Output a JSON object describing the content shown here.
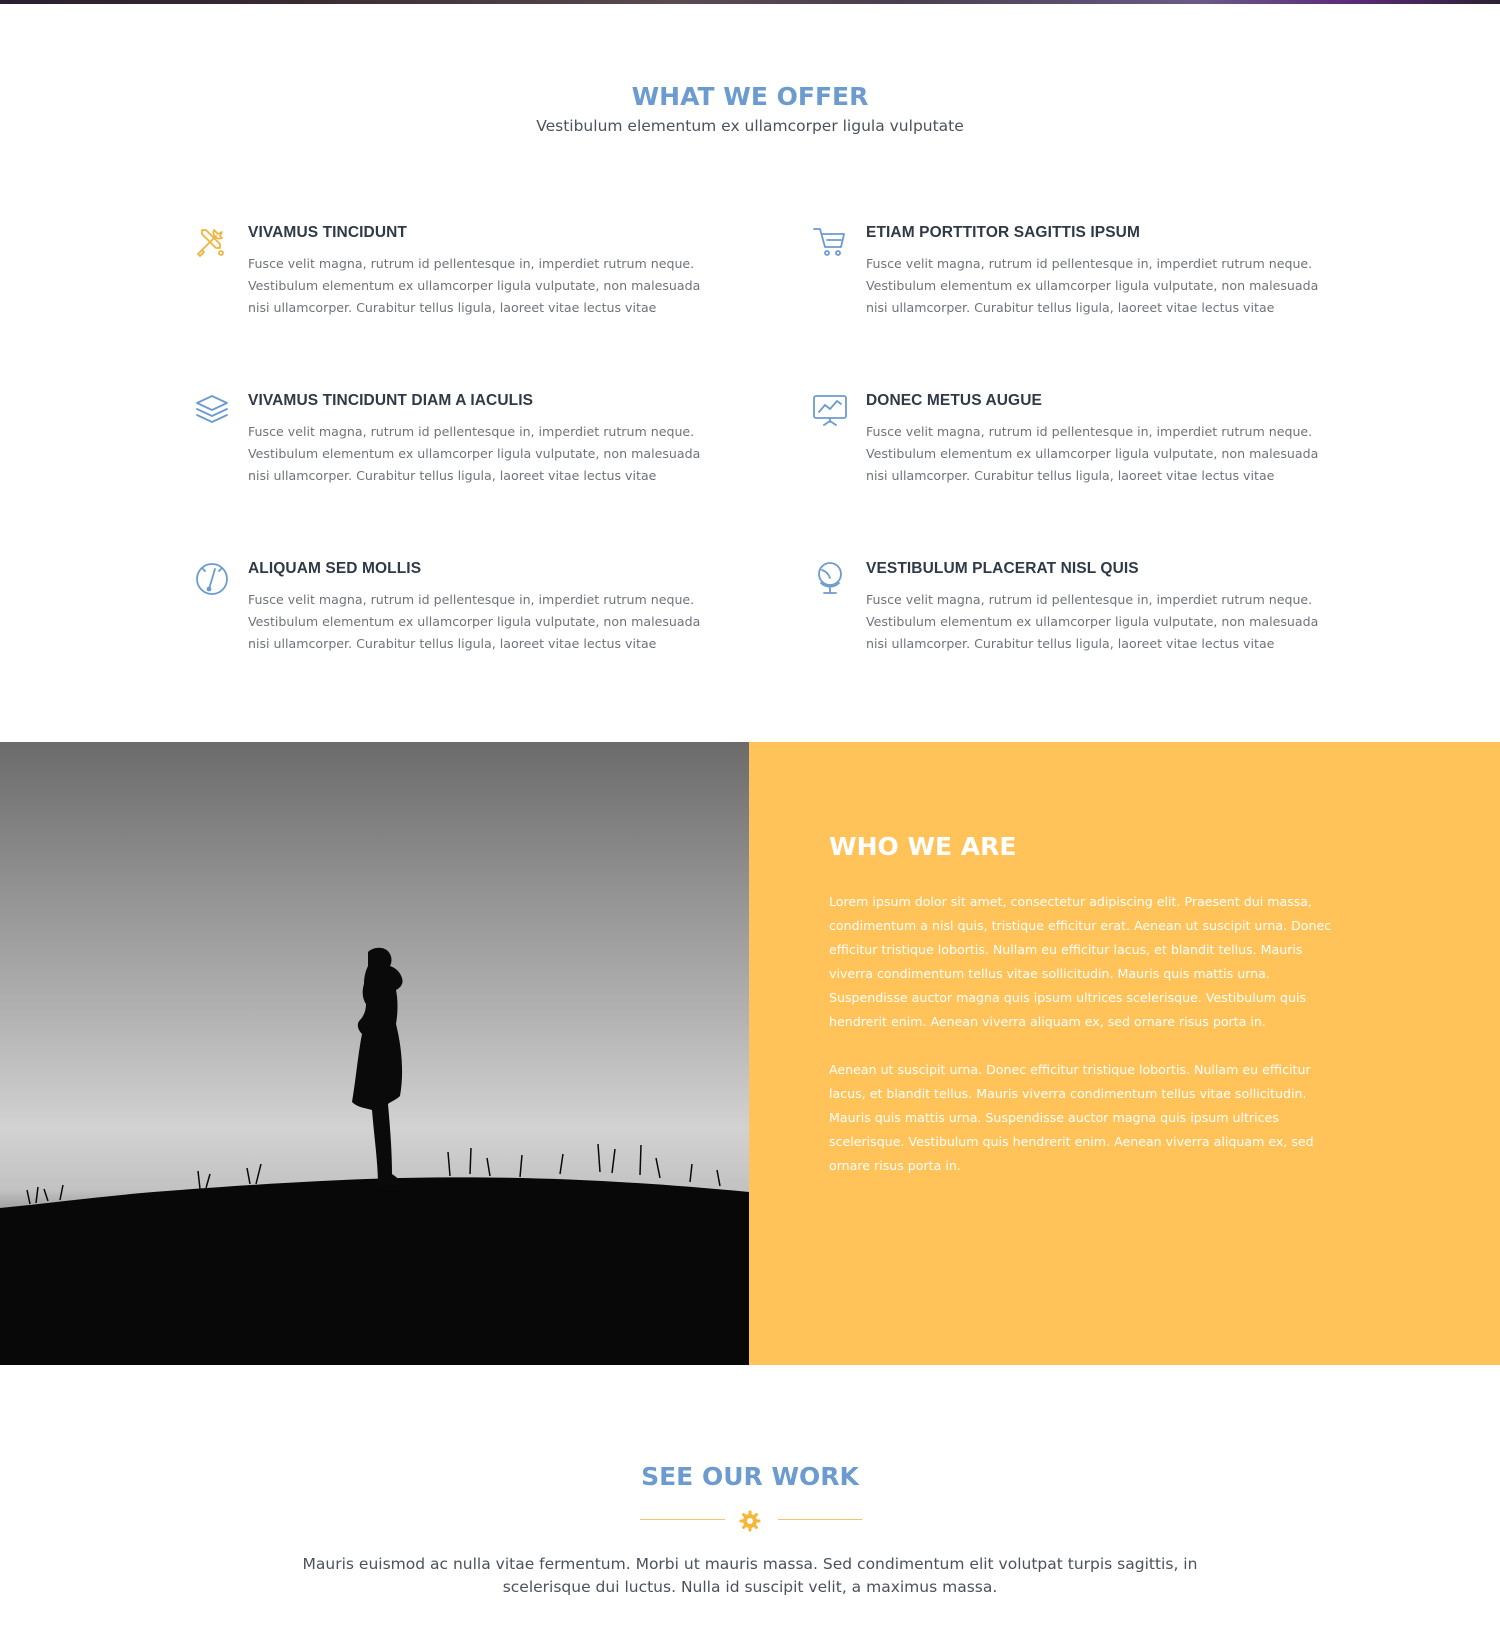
{
  "colors": {
    "accent_blue": "#6c9bcf",
    "accent_yellow": "#ffc35a",
    "heading_dark": "#2f3a46",
    "body_gray": "#6e737a"
  },
  "offer": {
    "title": "WHAT WE OFFER",
    "subtitle": "Vestibulum elementum ex ullamcorper ligula vulputate",
    "features": [
      {
        "icon": "tools-icon",
        "title": "VIVAMUS TINCIDUNT",
        "text": "Fusce velit magna, rutrum id pellentesque in, imperdiet rutrum neque. Vestibulum elementum ex ullamcorper ligula vulputate, non malesuada nisi ullamcorper. Curabitur tellus ligula, laoreet vitae lectus vitae"
      },
      {
        "icon": "shopping-cart-icon",
        "title": "ETIAM PORTTITOR SAGITTIS IPSUM",
        "text": "Fusce velit magna, rutrum id pellentesque in, imperdiet rutrum neque. Vestibulum elementum ex ullamcorper ligula vulputate, non malesuada nisi ullamcorper. Curabitur tellus ligula, laoreet vitae lectus vitae"
      },
      {
        "icon": "layers-icon",
        "title": "VIVAMUS TINCIDUNT DIAM A IACULIS",
        "text": "Fusce velit magna, rutrum id pellentesque in, imperdiet rutrum neque. Vestibulum elementum ex ullamcorper ligula vulputate, non malesuada nisi ullamcorper. Curabitur tellus ligula, laoreet vitae lectus vitae"
      },
      {
        "icon": "presentation-chart-icon",
        "title": "DONEC METUS AUGUE",
        "text": "Fusce velit magna, rutrum id pellentesque in, imperdiet rutrum neque. Vestibulum elementum ex ullamcorper ligula vulputate, non malesuada nisi ullamcorper. Curabitur tellus ligula, laoreet vitae lectus vitae"
      },
      {
        "icon": "speedometer-icon",
        "title": "ALIQUAM SED MOLLIS",
        "text": "Fusce velit magna, rutrum id pellentesque in, imperdiet rutrum neque. Vestibulum elementum ex ullamcorper ligula vulputate, non malesuada nisi ullamcorper. Curabitur tellus ligula, laoreet vitae lectus vitae"
      },
      {
        "icon": "globe-icon",
        "title": "VESTIBULUM PLACERAT NISL QUIS",
        "text": "Fusce velit magna, rutrum id pellentesque in, imperdiet rutrum neque. Vestibulum elementum ex ullamcorper ligula vulputate, non malesuada nisi ullamcorper. Curabitur tellus ligula, laoreet vitae lectus vitae"
      }
    ]
  },
  "who": {
    "title": "WHO WE ARE",
    "paragraph1": "Lorem ipsum dolor sit amet, consectetur adipiscing elit. Praesent dui massa, condimentum a nisl quis, tristique efficitur erat. Aenean ut suscipit urna. Donec efficitur tristique lobortis. Nullam eu efficitur lacus, et blandit tellus. Mauris viverra condimentum tellus vitae sollicitudin. Mauris quis mattis urna. Suspendisse auctor magna quis ipsum ultrices scelerisque. Vestibulum quis hendrerit enim. Aenean viverra aliquam ex, sed ornare risus porta in.",
    "paragraph2": "Aenean ut suscipit urna. Donec efficitur tristique lobortis. Nullam eu efficitur lacus, et blandit tellus. Mauris viverra condimentum tellus vitae sollicitudin. Mauris quis mattis urna. Suspendisse auctor magna quis ipsum ultrices scelerisque. Vestibulum quis hendrerit enim. Aenean viverra aliquam ex, sed ornare risus porta in."
  },
  "work": {
    "title": "SEE OUR WORK",
    "divider_icon": "gear-icon",
    "text": "Mauris euismod ac nulla vitae fermentum. Morbi ut mauris massa. Sed condimentum elit volutpat turpis sagittis, in scelerisque dui luctus. Nulla id suscipit velit, a maximus massa."
  }
}
